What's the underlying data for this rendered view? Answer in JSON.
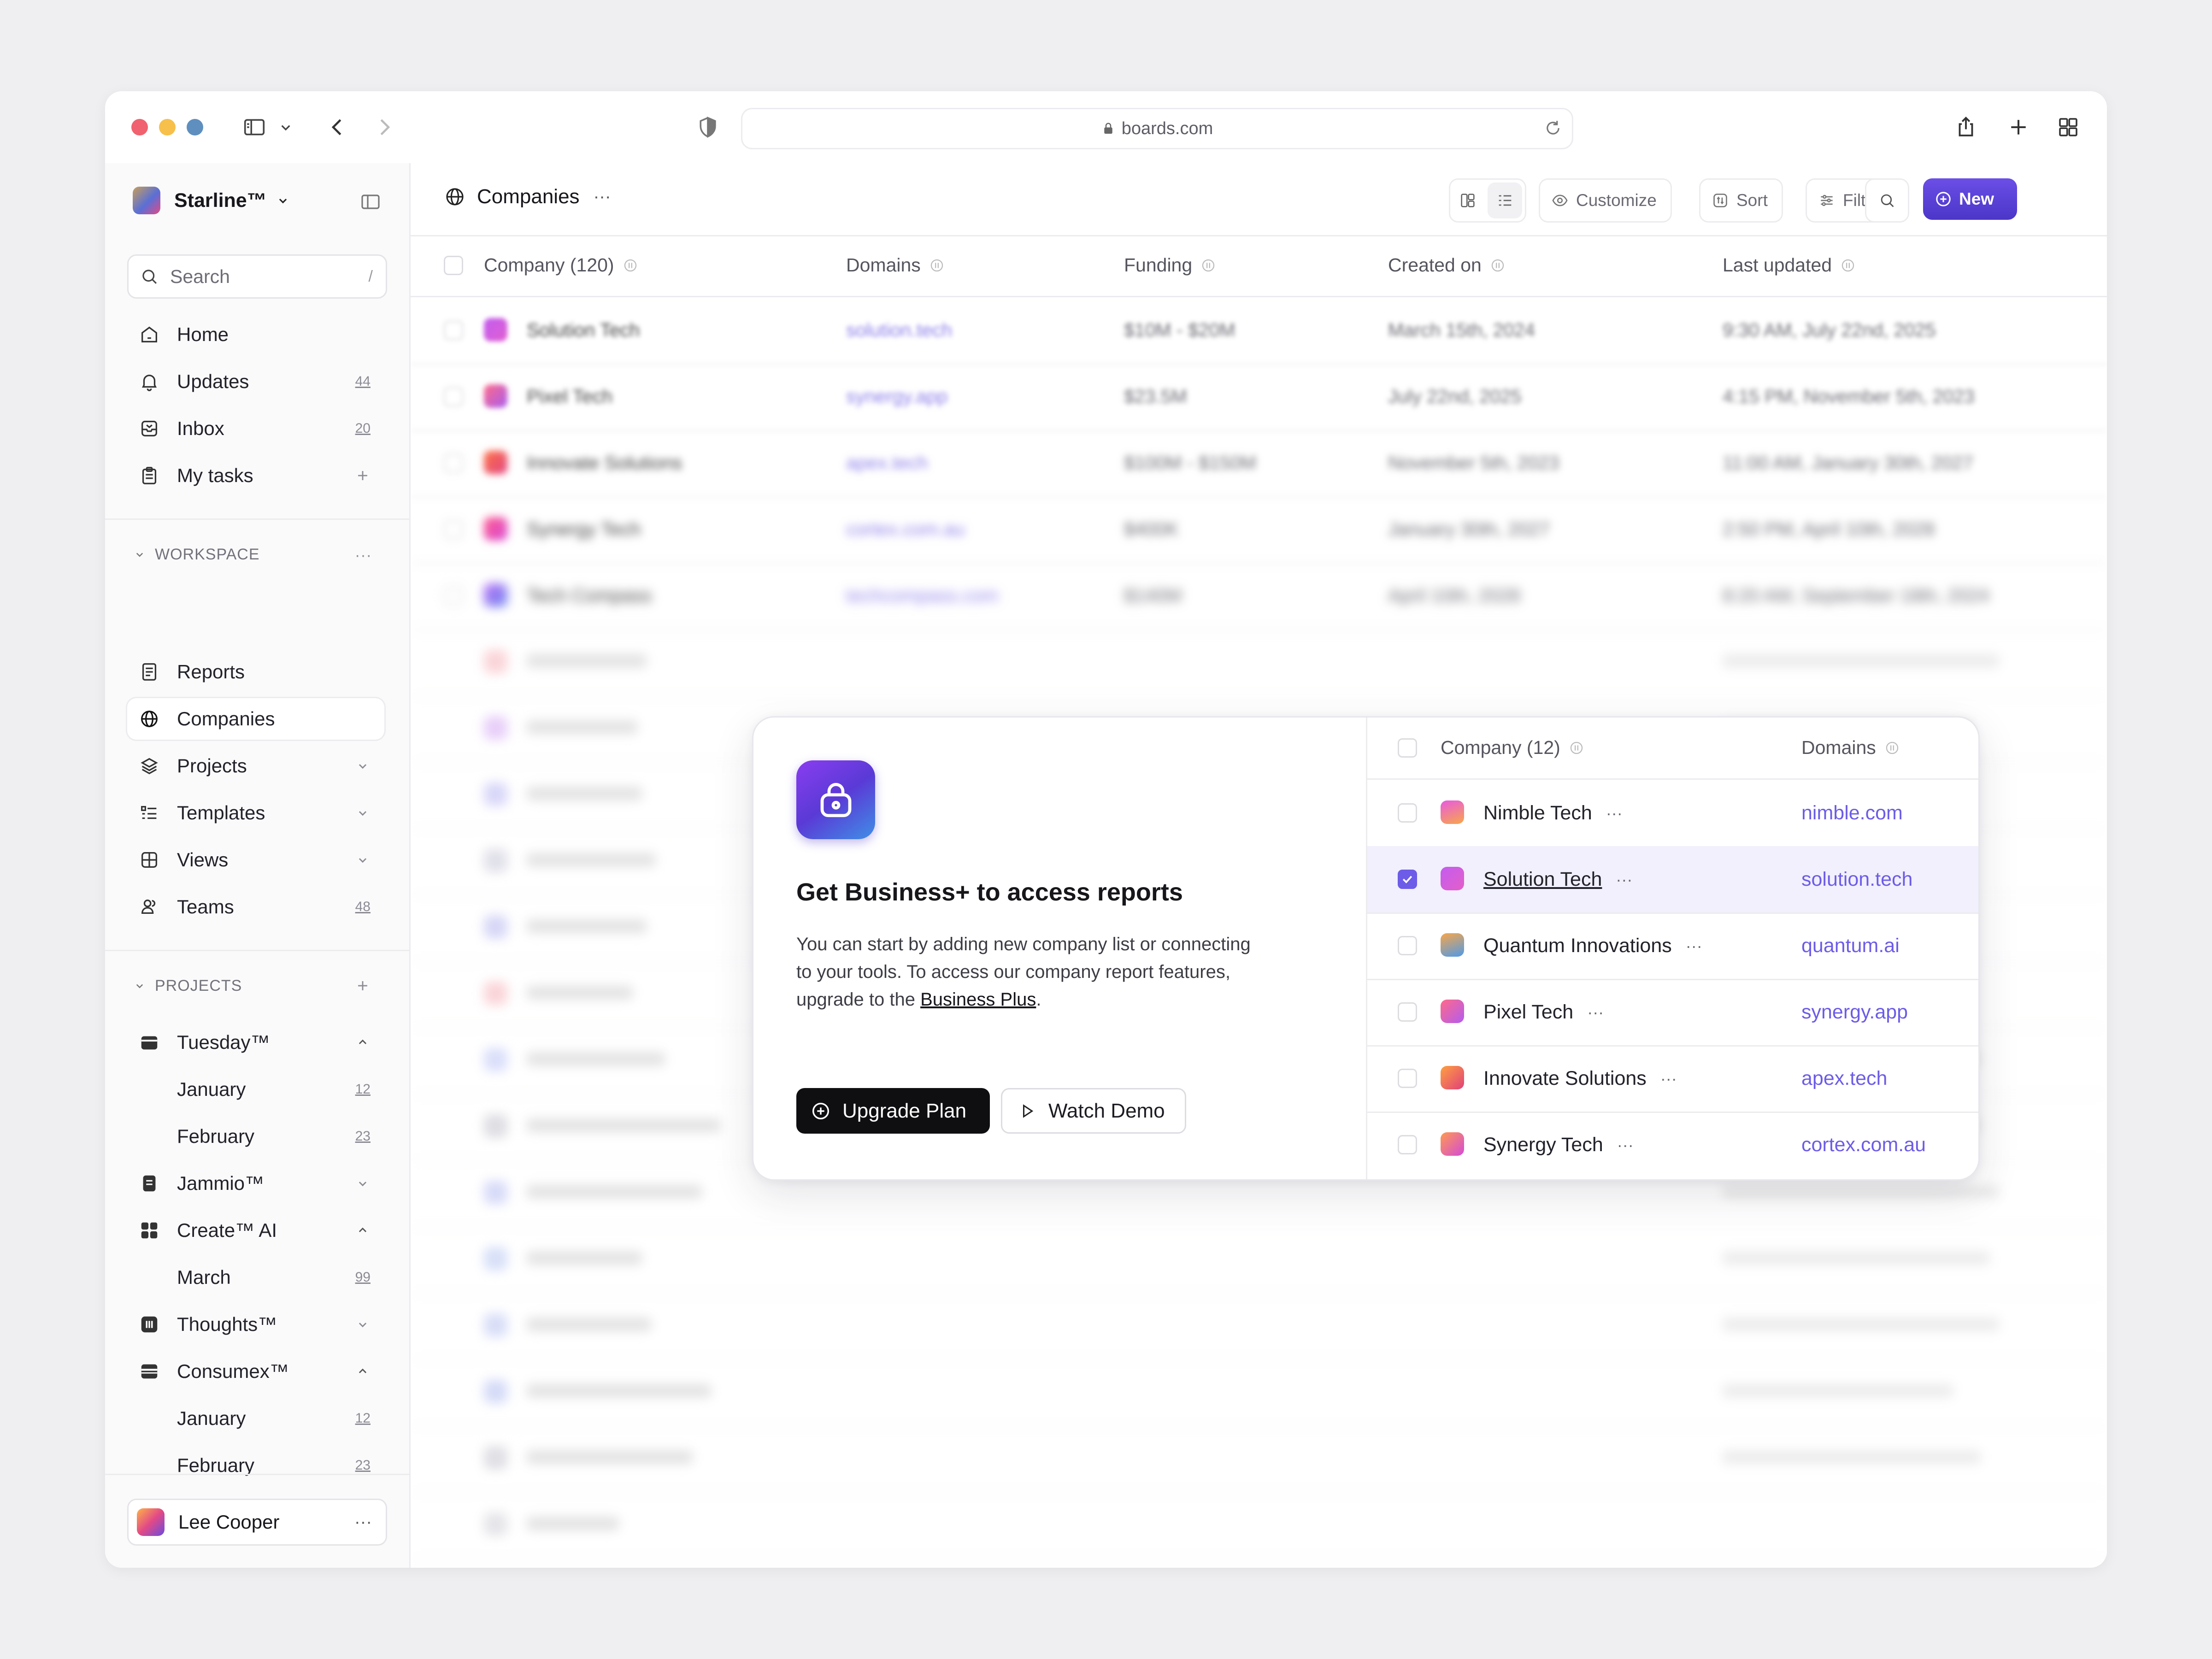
{
  "browser": {
    "url": "boards.com"
  },
  "sidebar": {
    "workspace_name": "Starline™",
    "search": {
      "placeholder": "Search",
      "shortcut": "/"
    },
    "nav": [
      {
        "label": "Home",
        "icon": "home-icon"
      },
      {
        "label": "Updates",
        "icon": "bell-icon",
        "count": "44"
      },
      {
        "label": "Inbox",
        "icon": "inbox-icon",
        "count": "20"
      },
      {
        "label": "My tasks",
        "icon": "clipboard-icon"
      }
    ],
    "workspace_section": {
      "title": "WORKSPACE",
      "items": [
        {
          "label": "Reports",
          "icon": "report-icon"
        },
        {
          "label": "Companies",
          "icon": "globe-icon",
          "active": true
        },
        {
          "label": "Projects",
          "icon": "layers-icon"
        },
        {
          "label": "Templates",
          "icon": "list-icon"
        },
        {
          "label": "Views",
          "icon": "grid-icon"
        },
        {
          "label": "Teams",
          "icon": "users-icon",
          "count": "48"
        }
      ]
    },
    "projects_section": {
      "title": "PROJECTS",
      "items": [
        {
          "label": "Tuesday™",
          "icon": "calendar-icon",
          "expanded": true
        },
        {
          "label": "January",
          "count": "12",
          "sub": true
        },
        {
          "label": "February",
          "count": "23",
          "sub": true
        },
        {
          "label": "Jammio™",
          "icon": "note-icon"
        },
        {
          "label": "Create™ AI",
          "icon": "apps-icon",
          "expanded": true
        },
        {
          "label": "March",
          "count": "99",
          "sub": true
        },
        {
          "label": "Thoughts™",
          "icon": "bars-icon"
        },
        {
          "label": "Consumex™",
          "icon": "card-icon",
          "expanded": true
        },
        {
          "label": "January",
          "count": "12",
          "sub": true
        },
        {
          "label": "February",
          "count": "23",
          "sub": true
        }
      ]
    },
    "user": {
      "name": "Lee Cooper"
    }
  },
  "main": {
    "title": "Companies",
    "toolbar": {
      "customize": "Customize",
      "sort": "Sort",
      "filter": "Filter",
      "new": "New"
    },
    "columns": [
      "Company (120)",
      "Domains",
      "Funding",
      "Created on",
      "Last updated"
    ],
    "rows": [
      {
        "company": "Solution Tech",
        "domain": "solution.tech",
        "funding": "$10M - $20M",
        "created": "March 15th, 2024",
        "updated": "9:30 AM, July 22nd, 2025"
      },
      {
        "company": "Pixel Tech",
        "domain": "synergy.app",
        "funding": "$23.5M",
        "created": "July 22nd, 2025",
        "updated": "4:15 PM, November 5th, 2023"
      },
      {
        "company": "Innovate Solutions",
        "domain": "apex.tech",
        "funding": "$100M - $150M",
        "created": "November 5th, 2023",
        "updated": "11:00 AM, January 30th, 2027"
      },
      {
        "company": "Synergy Tech",
        "domain": "cortex.com.au",
        "funding": "$400K",
        "created": "January 30th, 2027",
        "updated": "2:50 PM, April 10th, 2028"
      },
      {
        "company": "Tech Compass",
        "domain": "techcompass.com",
        "funding": "$140M",
        "created": "April 10th, 2028",
        "updated": "8:20 AM, September 18th, 2024"
      }
    ]
  },
  "modal": {
    "title": "Get Business+ to access reports",
    "description": "You can start by adding new company list or connecting to your tools. To access our company report features, upgrade to the",
    "link": "Business Plus",
    "period": ".",
    "primary_button": "Upgrade Plan",
    "secondary_button": "Watch Demo",
    "table": {
      "col_company": "Company (12)",
      "col_domains": "Domains",
      "rows": [
        {
          "company": "Nimble Tech",
          "domain": "nimble.com",
          "selected": false
        },
        {
          "company": "Solution Tech",
          "domain": "solution.tech",
          "selected": true
        },
        {
          "company": "Quantum Innovations",
          "domain": "quantum.ai",
          "selected": false
        },
        {
          "company": "Pixel Tech",
          "domain": "synergy.app",
          "selected": false
        },
        {
          "company": "Innovate Solutions",
          "domain": "apex.tech",
          "selected": false
        },
        {
          "company": "Synergy Tech",
          "domain": "cortex.com.au",
          "selected": false
        }
      ]
    }
  },
  "colors": {
    "accent": "#6c5ce7",
    "primary_button": "#0f0f12",
    "new_button": "#5a3fd8"
  }
}
